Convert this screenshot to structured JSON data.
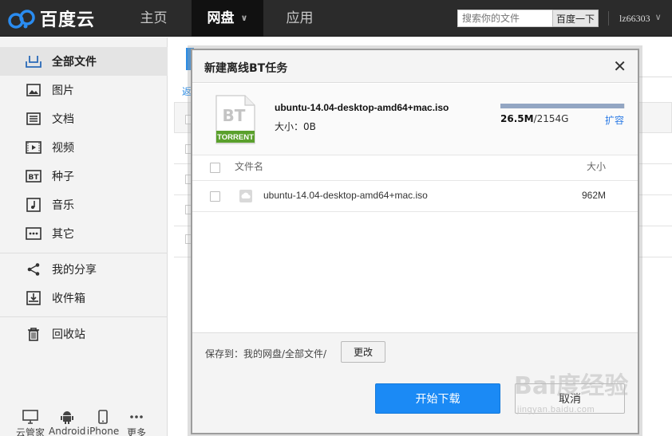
{
  "topbar": {
    "logo_text": "百度云",
    "nav": [
      {
        "label": "主页"
      },
      {
        "label": "网盘"
      },
      {
        "label": "应用"
      }
    ],
    "search": {
      "placeholder": "搜索你的文件",
      "button": "百度一下"
    },
    "user": "lz66303"
  },
  "sidebar": {
    "items": [
      {
        "label": "全部文件"
      },
      {
        "label": "图片"
      },
      {
        "label": "文档"
      },
      {
        "label": "视频"
      },
      {
        "label": "种子"
      },
      {
        "label": "音乐"
      },
      {
        "label": "其它"
      },
      {
        "label": "我的分享"
      },
      {
        "label": "收件箱"
      },
      {
        "label": "回收站"
      }
    ],
    "devices": [
      {
        "label": "云管家"
      },
      {
        "label": "Android"
      },
      {
        "label": "iPhone"
      },
      {
        "label": "更多"
      }
    ]
  },
  "background": {
    "back_link": "返"
  },
  "dialog": {
    "title": "新建离线BT任务",
    "close": "✕",
    "torrent": {
      "icon_text": "BT",
      "icon_label": "TORRENT",
      "file_name": "ubuntu-14.04-desktop-amd64+mac.iso",
      "size_label": "大小：0B"
    },
    "quota": {
      "used": "26.5M",
      "total": "/2154G",
      "fraction": 0.012,
      "expand": "扩容"
    },
    "list": {
      "col_name": "文件名",
      "col_size": "大小",
      "rows": [
        {
          "name": "ubuntu-14.04-desktop-amd64+mac.iso",
          "size": "962M"
        }
      ]
    },
    "save_to": "保存到：我的网盘/全部文件/",
    "change_button": "更改",
    "start_button": "开始下载",
    "cancel_button": "取消"
  },
  "watermark": {
    "text": "Bai度经验",
    "sub": "jingyan.baidu.com"
  },
  "colors": {
    "accent": "#1b8af5",
    "topbar": "#2b2b2b",
    "torrent_green": "#5aa02c"
  }
}
